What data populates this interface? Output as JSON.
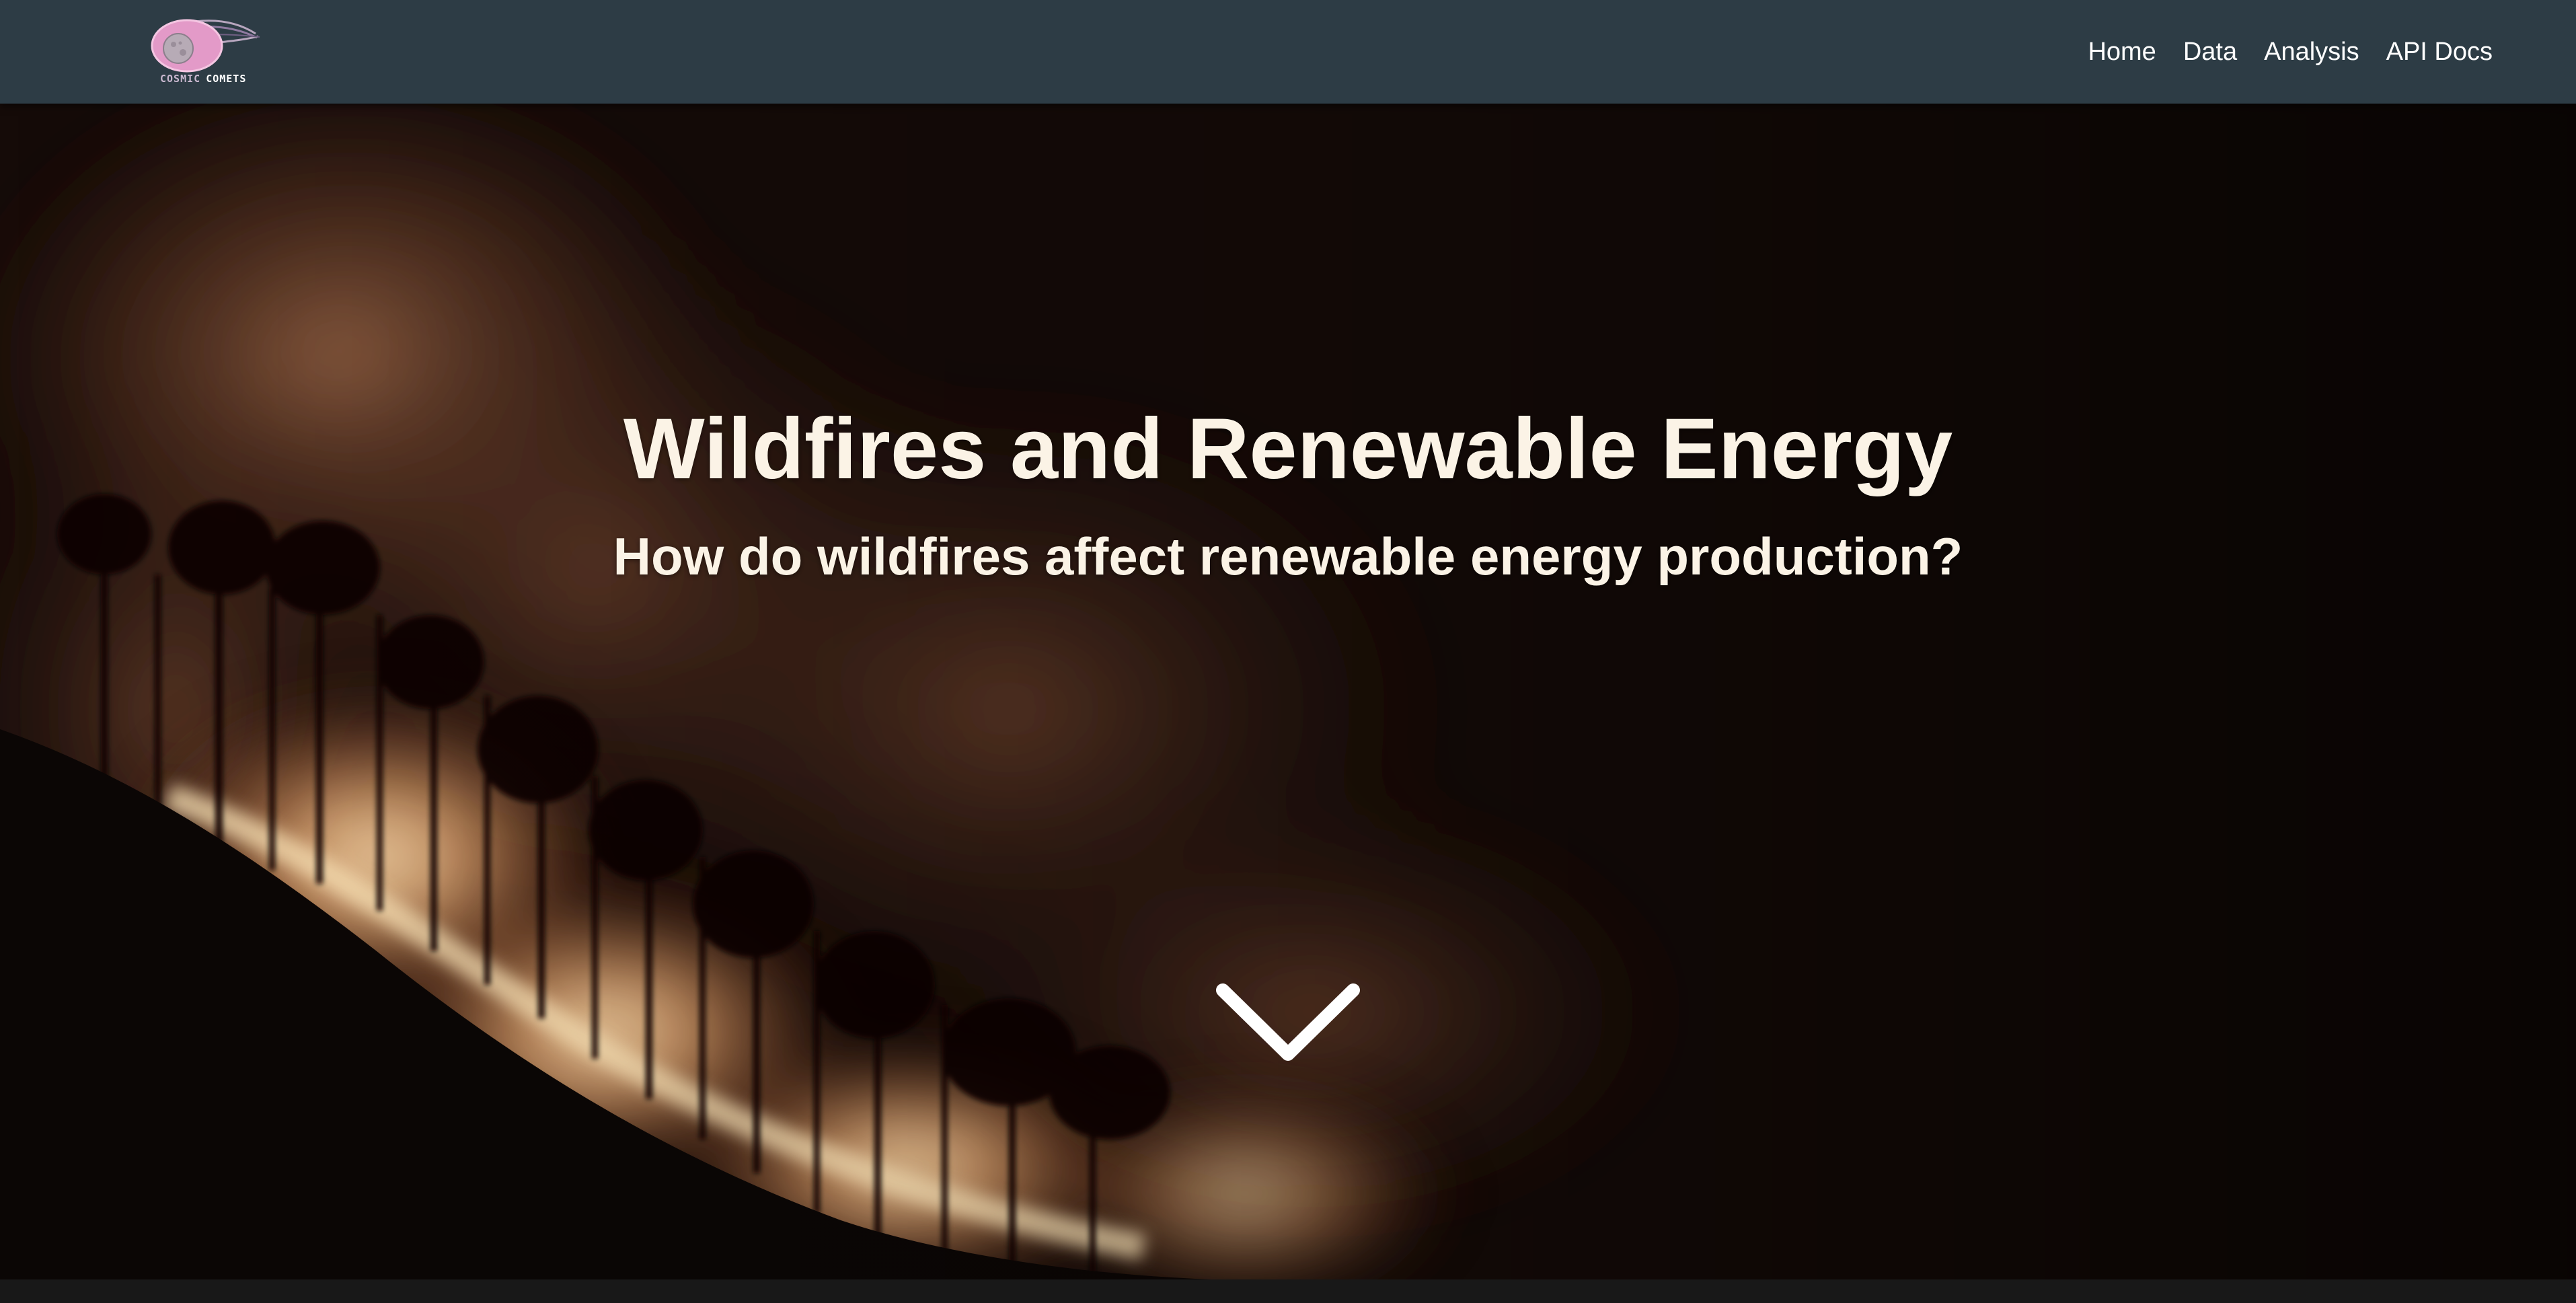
{
  "brand": {
    "logo_text_1": "COSMIC",
    "logo_text_2": "COMETS",
    "logo_icon": "comet-icon"
  },
  "nav": {
    "items": [
      {
        "label": "Home"
      },
      {
        "label": "Data"
      },
      {
        "label": "Analysis"
      },
      {
        "label": "API Docs"
      }
    ]
  },
  "hero": {
    "title": "Wildfires and Renewable Energy",
    "subtitle": "How do wildfires affect renewable energy production?",
    "scroll_icon": "chevron-down-icon"
  },
  "colors": {
    "navbar_bg": "#2d3c45",
    "hero_text": "#fbf3e6",
    "fire_glow": "#f0b57a",
    "logo_pink": "#e39ac8"
  }
}
